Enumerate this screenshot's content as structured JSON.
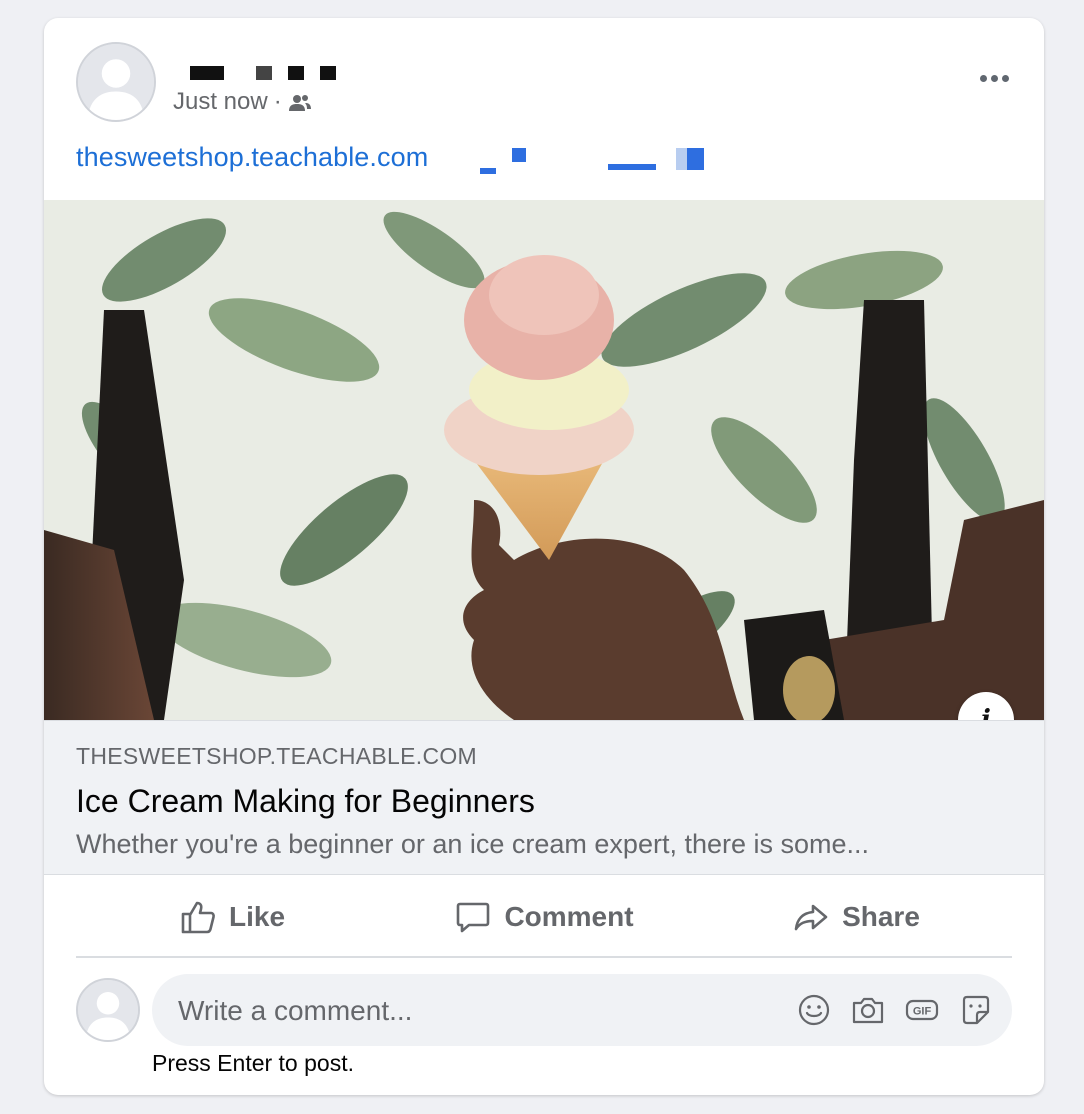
{
  "post": {
    "time": "Just now",
    "separator": "·",
    "audience_icon": "friends-icon",
    "link_text": "thesweetshop.teachable.com",
    "more_icon": "more-horizontal-icon"
  },
  "link_preview": {
    "domain": "THESWEETSHOP.TEACHABLE.COM",
    "title": "Ice Cream Making for Beginners",
    "description": "Whether you're a beginner or an ice cream expert, there is some...",
    "info_label": "i"
  },
  "actions": [
    {
      "label": "Like",
      "icon": "thumbs-up-icon"
    },
    {
      "label": "Comment",
      "icon": "comment-icon"
    },
    {
      "label": "Share",
      "icon": "share-icon"
    }
  ],
  "comment": {
    "placeholder": "Write a comment...",
    "hint": "Press Enter to post.",
    "icons": [
      "emoji-icon",
      "camera-icon",
      "gif-icon",
      "sticker-icon"
    ]
  },
  "colors": {
    "link": "#1d6fd6",
    "muted": "#65676b",
    "background": "#eff0f4"
  }
}
